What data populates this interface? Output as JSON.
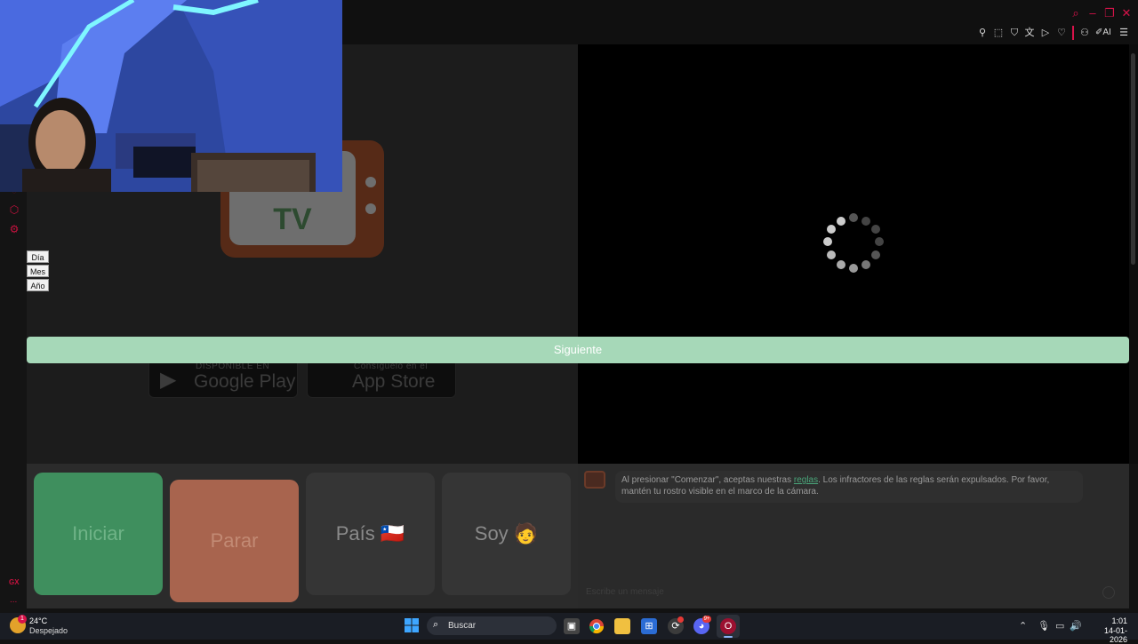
{
  "browser": {
    "toolbar_icons": [
      "pin-icon",
      "snapshot-icon",
      "shield-icon",
      "translate-icon",
      "play-icon",
      "heart-icon",
      "account-icon",
      "ai-icon",
      "menu-icon"
    ],
    "ai_label": "AI",
    "window_controls": [
      "search-icon",
      "minimize-icon",
      "restore-icon",
      "close-icon"
    ],
    "sidebar_icons": [
      "home-icon",
      "extensions-icon",
      "settings-icon"
    ],
    "sidebar_bottom": "GX",
    "sidebar_more": "..."
  },
  "logo": {
    "text": "TV"
  },
  "date_options": {
    "day": "Día",
    "month": "Mes",
    "year": "Año"
  },
  "next_button": "Siguiente",
  "store_badges": {
    "google_small": "DISPONIBLE EN",
    "google_big": "Google Play",
    "apple_small": "Consíguelo en el",
    "apple_big": "App Store"
  },
  "controls": {
    "start": "Iniciar",
    "stop": "Parar",
    "country": "País",
    "country_flag": "🇨🇱",
    "me": "Soy",
    "me_emoji": "🧑"
  },
  "chat": {
    "message_prefix": "Al presionar \"Comenzar\", aceptas nuestras ",
    "rules_link": "reglas",
    "message_suffix": ". Los infractores de las reglas serán expulsados. Por favor, mantén tu rostro visible en el marco de la cámara.",
    "input_placeholder": "Escribe un mensaje"
  },
  "taskbar": {
    "weather_temp": "24°C",
    "weather_desc": "Despejado",
    "weather_badge": "1",
    "search_placeholder": "Buscar",
    "discord_badge": "9+",
    "time": "1:01",
    "date": "14-01-2026"
  },
  "colors": {
    "accent": "#d8134a",
    "next_button": "#a6d8b8",
    "start_card": "#3f8f5e",
    "stop_card": "#a8644e"
  }
}
